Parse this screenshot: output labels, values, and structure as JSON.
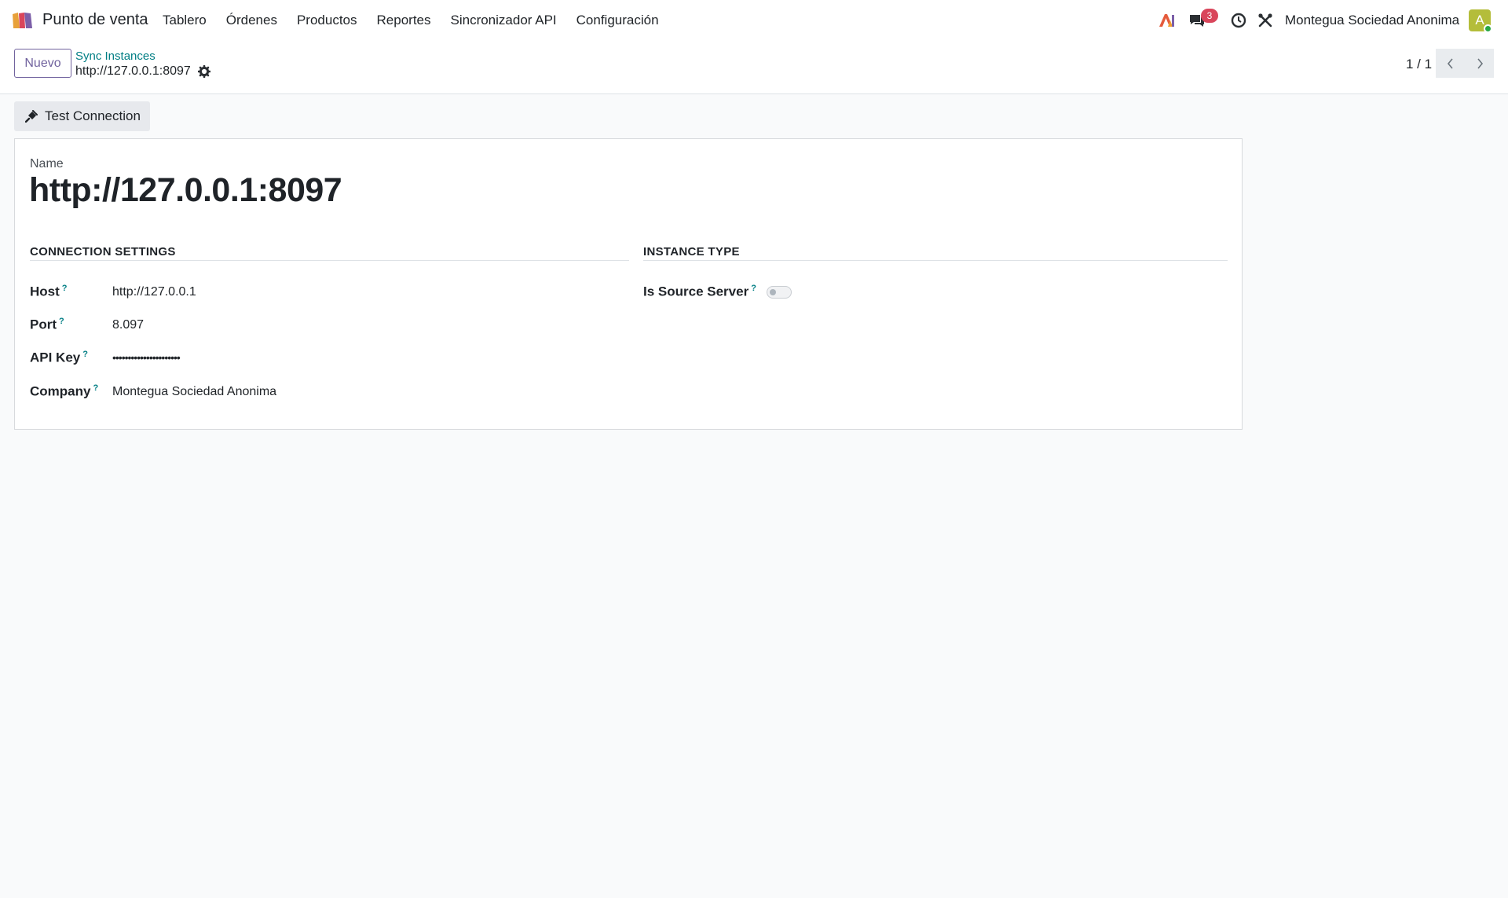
{
  "navbar": {
    "app_name": "Punto de venta",
    "menu": [
      "Tablero",
      "Órdenes",
      "Productos",
      "Reportes",
      "Sincronizador API",
      "Configuración"
    ],
    "messages_count": "3",
    "company": "Montegua Sociedad Anonima",
    "avatar_initial": "A",
    "icons": [
      "app-logo-icon",
      "ai-icon",
      "chat-icon",
      "activity-clock-icon",
      "debug-tools-icon"
    ]
  },
  "control_panel": {
    "new_button": "Nuevo",
    "breadcrumb_parent": "Sync Instances",
    "breadcrumb_current": "http://127.0.0.1:8097",
    "pager": "1 / 1"
  },
  "form": {
    "test_connection_label": "Test Connection",
    "name_label": "Name",
    "name_value": "http://127.0.0.1:8097",
    "connection_group": {
      "title": "CONNECTION SETTINGS",
      "fields": [
        {
          "label": "Host",
          "help": "?",
          "value": "http://127.0.0.1"
        },
        {
          "label": "Port",
          "help": "?",
          "value": "8.097"
        },
        {
          "label": "API Key",
          "help": "?",
          "value": "••••••••••••••••••••••"
        },
        {
          "label": "Company",
          "help": "?",
          "value": "Montegua Sociedad Anonima"
        }
      ]
    },
    "instance_group": {
      "title": "INSTANCE TYPE",
      "fields": [
        {
          "label": "Is Source Server",
          "help": "?",
          "value": false
        }
      ]
    }
  },
  "colors": {
    "accent": "#71639e",
    "link": "#017e84",
    "badge": "#d9465b",
    "avatar": "#b4bd3a"
  }
}
